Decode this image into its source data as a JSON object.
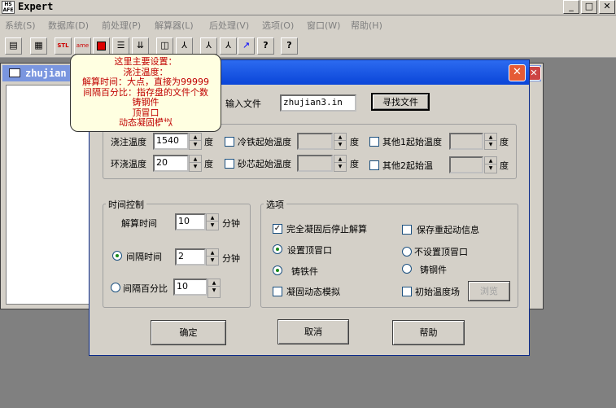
{
  "app": {
    "icon_text_top": "HS",
    "icon_text_bottom": "AFE",
    "title": "Expert",
    "window_buttons": [
      "_",
      "□",
      "✕"
    ]
  },
  "menu": [
    "系统(S)",
    "数据库(D)",
    "前处理(P)",
    "解算器(L)",
    "后处理(V)",
    "选项(O)",
    "窗口(W)",
    "帮助(H)"
  ],
  "toolbar_icons": [
    "new-doc-icon",
    "table-icon",
    "stl-icon",
    "ame-icon",
    "stop-icon",
    "list-icon",
    "list-down-icon",
    "split-icon",
    "anchor-icon-1",
    "anchor-icon-2",
    "anchor-icon-3",
    "chart-icon",
    "help-icon",
    "context-help-icon"
  ],
  "toolbar_glyphs": {
    "stl": "STL",
    "ame": "ame",
    "help": "?",
    "context": "?"
  },
  "child_window": {
    "title": "zhujian"
  },
  "tooltip": {
    "lines": [
      "这里主要设置：",
      "浇注温度：",
      "解算时间：大点，直接为99999",
      "间隔百分比：指存盘的文件个数",
      "铸钢件",
      "顶冒口",
      "动态凝固模拟"
    ]
  },
  "dialog": {
    "input_file_label": "输入文件",
    "input_file_value": "zhujian3.in",
    "find_file_button": "寻找文件",
    "pour_temp_label": "浇注温度",
    "pour_temp_value": "1540",
    "ambient_temp_label": "环浇温度",
    "ambient_temp_value": "20",
    "unit_degree": "度",
    "iron_start_label": "冷铁起始温度",
    "sand_core_start_label": "砂芯起始温度",
    "other1_start_label": "其他1起始温度",
    "other2_start_label": "其他2起始温",
    "time_group_title": "时间控制",
    "solve_time_label": "解算时间",
    "solve_time_value": "10",
    "unit_minute": "分钟",
    "interval_time_label": "间隔时间",
    "interval_time_value": "2",
    "interval_percent_label": "间隔百分比",
    "interval_percent_value": "10",
    "options_group_title": "选项",
    "stop_when_solid_label": "完全凝固后停止解算",
    "save_restart_label": "保存重起动信息",
    "set_riser_label": "设置顶冒口",
    "no_riser_label": "不设置顶冒口",
    "cast_iron_label": "铸铁件",
    "cast_steel_label": "铸钢件",
    "dynamic_sim_label": "凝固动态模拟",
    "initial_temp_field_label": "初始温度场",
    "browse_button": "浏览",
    "ok_button": "确定",
    "cancel_button": "取消",
    "help_button": "帮助",
    "checked_mark": "✓",
    "close_glyph": "✕"
  }
}
